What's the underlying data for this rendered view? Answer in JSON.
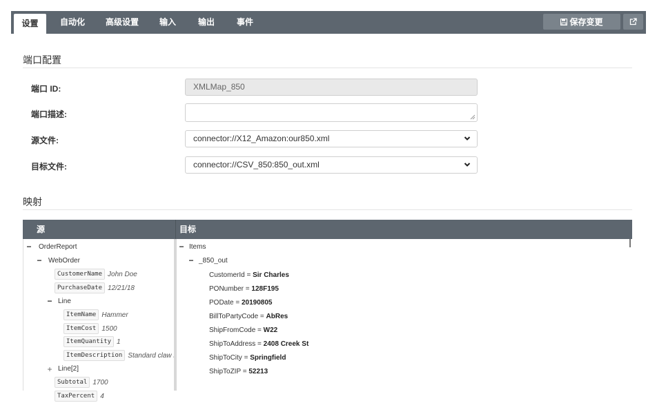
{
  "tabs": [
    {
      "label": "设置"
    },
    {
      "label": "自动化"
    },
    {
      "label": "高级设置"
    },
    {
      "label": "输入"
    },
    {
      "label": "输出"
    },
    {
      "label": "事件"
    }
  ],
  "toolbar": {
    "save_label": "保存变更",
    "save_icon": "save-icon",
    "external_icon": "external-link-icon"
  },
  "port_config": {
    "title": "端口配置",
    "port_id_label": "端口 ID:",
    "port_id_value": "XMLMap_850",
    "description_label": "端口描述:",
    "description_value": "",
    "source_label": "源文件:",
    "source_value": "connector://X12_Amazon:our850.xml",
    "target_label": "目标文件:",
    "target_value": "connector://CSV_850:850_out.xml"
  },
  "mapping": {
    "title": "映射",
    "source_header": "源",
    "target_header": "目标",
    "source_tree": {
      "root": "OrderReport",
      "web_order": "WebOrder",
      "customer_name": {
        "name": "CustomerName",
        "value": "John Doe"
      },
      "purchase_date": {
        "name": "PurchaseDate",
        "value": "12/21/18"
      },
      "line": "Line",
      "item_name": {
        "name": "ItemName",
        "value": "Hammer"
      },
      "item_cost": {
        "name": "ItemCost",
        "value": "1500"
      },
      "item_quantity": {
        "name": "ItemQuantity",
        "value": "1"
      },
      "item_description": {
        "name": "ItemDescription",
        "value": "Standard claw ho"
      },
      "line2": "Line[2]",
      "subtotal": {
        "name": "Subtotal",
        "value": "1700"
      },
      "tax_percent": {
        "name": "TaxPercent",
        "value": "4"
      }
    },
    "target_tree": {
      "root": "Items",
      "child": "_850_out",
      "fields": [
        {
          "name": "CustomerId = ",
          "value": "Sir Charles"
        },
        {
          "name": "PONumber = ",
          "value": "128F195"
        },
        {
          "name": "PODate = ",
          "value": "20190805"
        },
        {
          "name": "BillToPartyCode = ",
          "value": "AbRes"
        },
        {
          "name": "ShipFromCode = ",
          "value": "W22"
        },
        {
          "name": "ShipToAddress = ",
          "value": "2408 Creek St"
        },
        {
          "name": "ShipToCity = ",
          "value": "Springfield"
        },
        {
          "name": "ShipToZIP = ",
          "value": "52213"
        }
      ]
    }
  }
}
